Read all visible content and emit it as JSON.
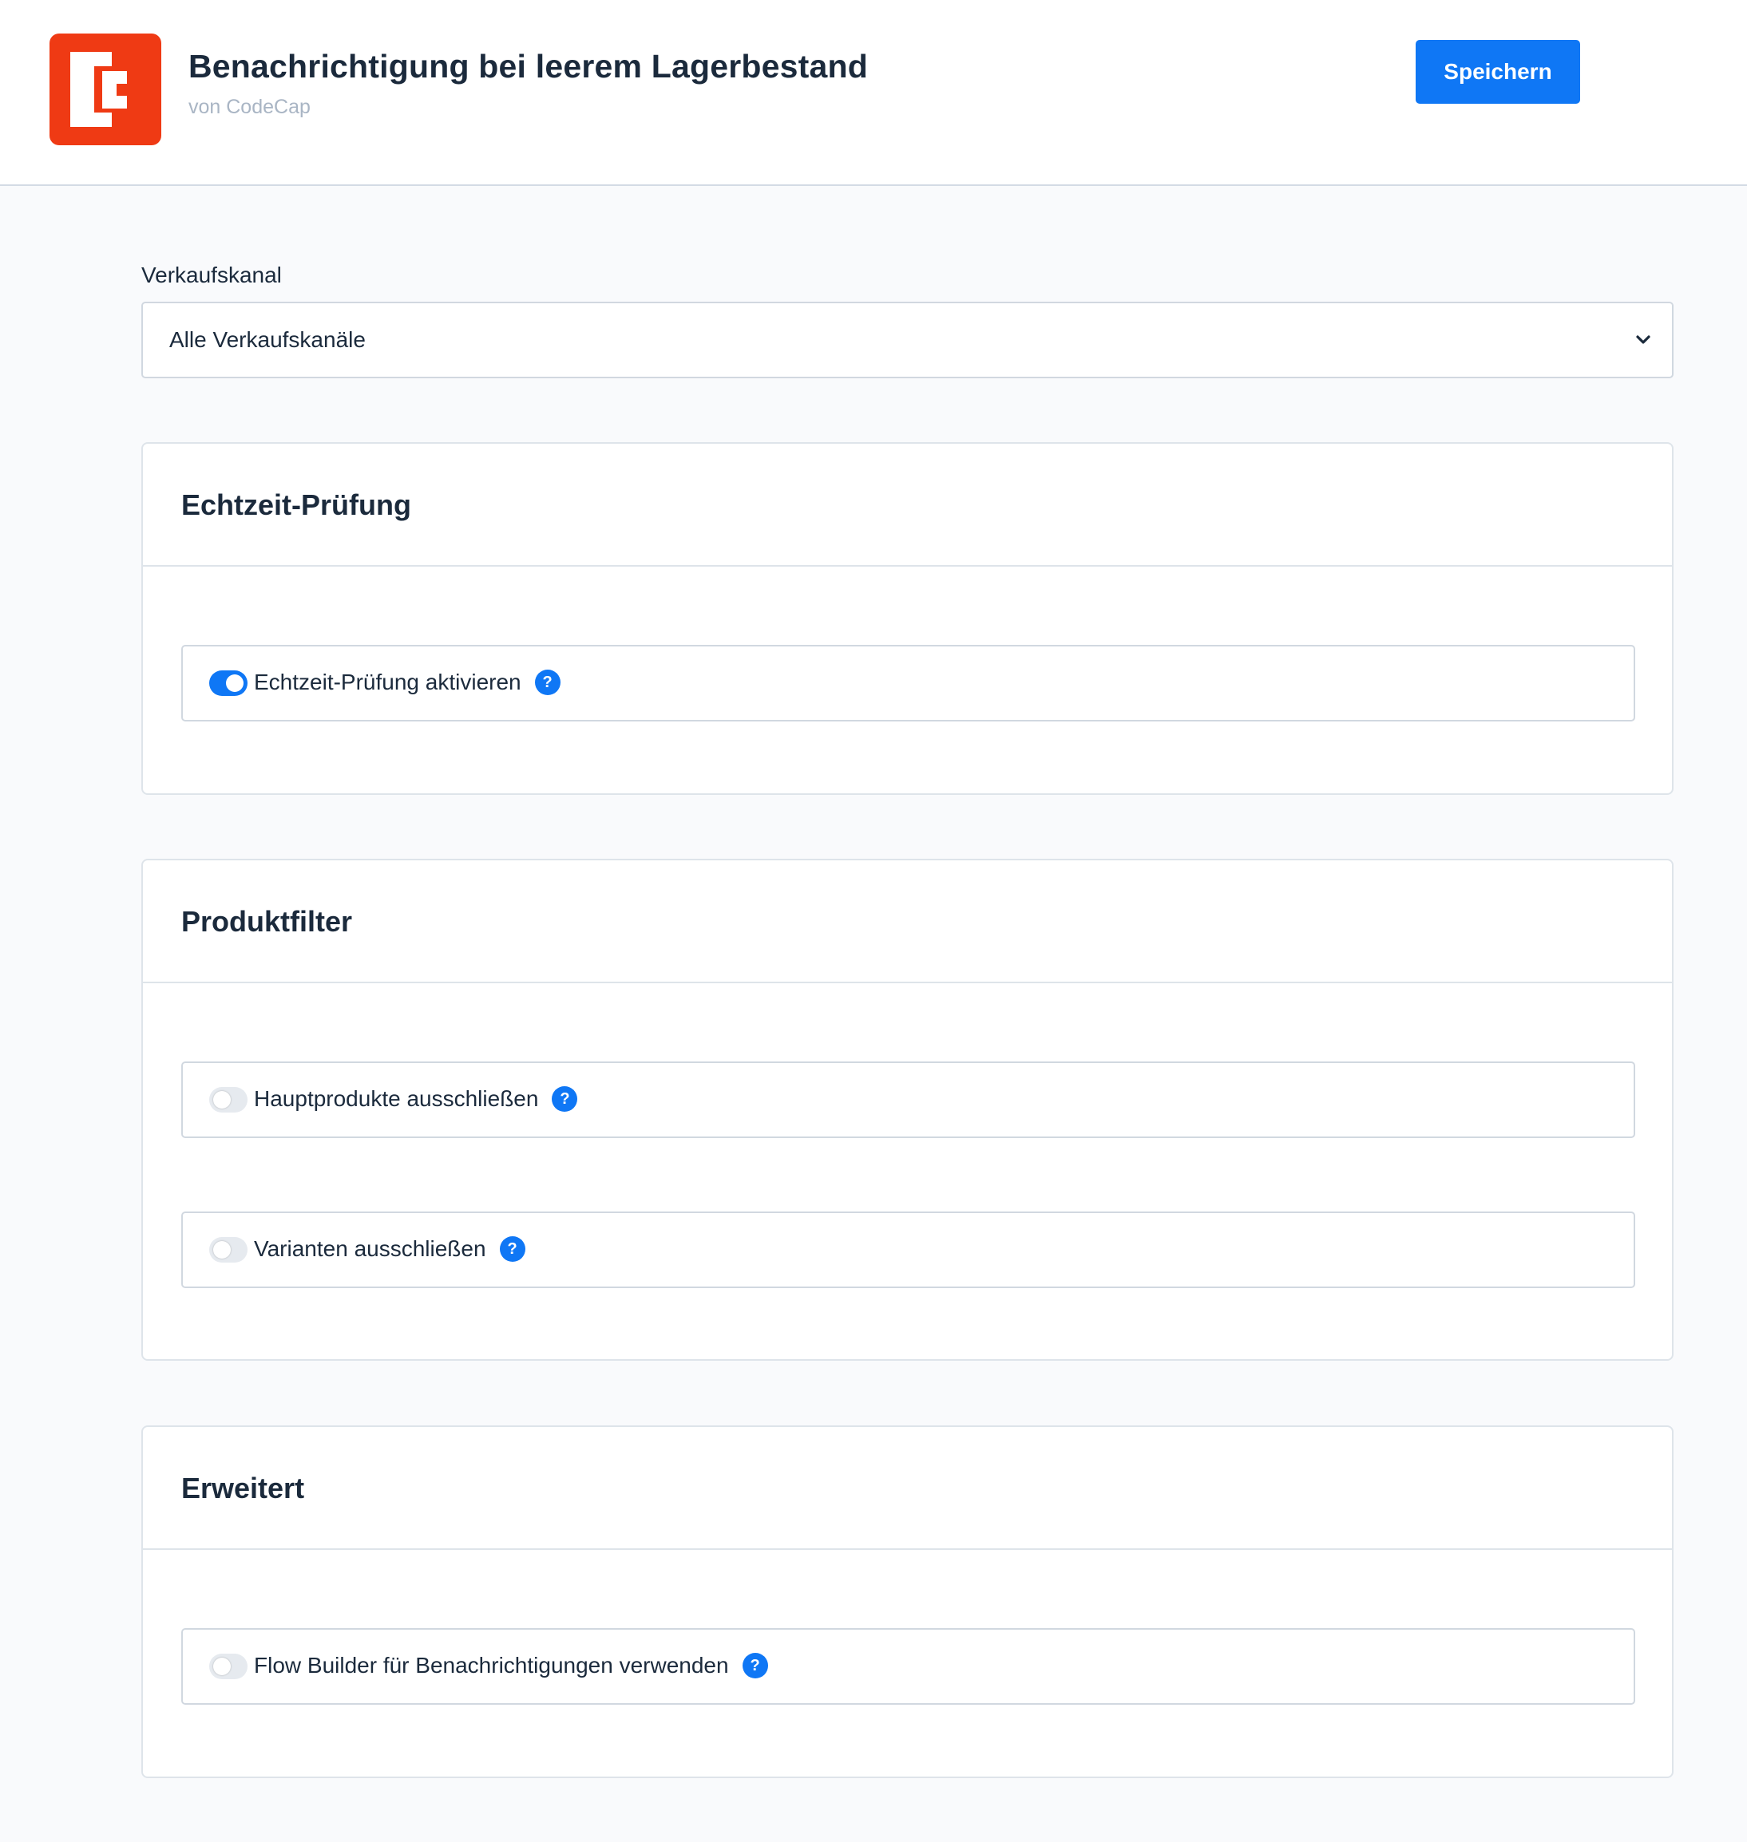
{
  "header": {
    "title": "Benachrichtigung bei leerem Lagerbestand",
    "vendor": "von CodeCap",
    "save_label": "Speichern",
    "logo_color": "#ef3a14",
    "accent_color": "#0f77f5"
  },
  "sales_channel": {
    "label": "Verkaufskanal",
    "selected": "Alle Verkaufskanäle"
  },
  "cards": [
    {
      "title": "Echtzeit-Prüfung",
      "settings": [
        {
          "label": "Echtzeit-Prüfung aktivieren",
          "enabled": true,
          "help_icon": "?"
        }
      ]
    },
    {
      "title": "Produktfilter",
      "settings": [
        {
          "label": "Hauptprodukte ausschließen",
          "enabled": false,
          "help_icon": "?"
        },
        {
          "label": "Varianten ausschließen",
          "enabled": false,
          "help_icon": "?"
        }
      ]
    },
    {
      "title": "Erweitert",
      "settings": [
        {
          "label": "Flow Builder für Benachrichtigungen verwenden",
          "enabled": false,
          "help_icon": "?"
        }
      ]
    }
  ]
}
